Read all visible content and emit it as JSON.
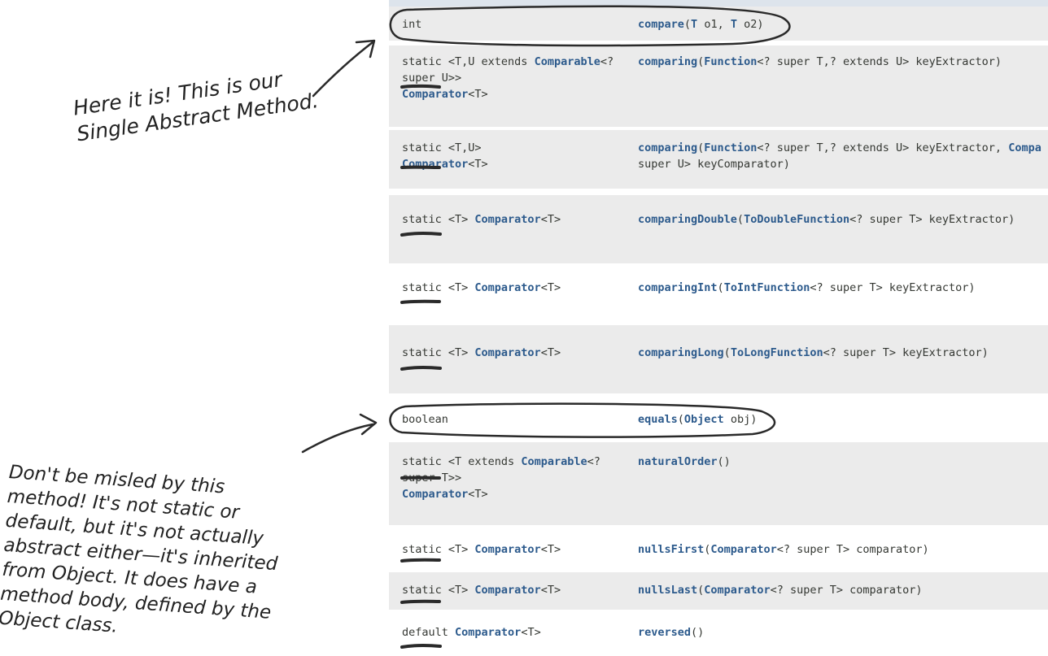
{
  "annotations": {
    "sam_note": "Here it is! This is our Single Abstract Method.",
    "equals_note": "Don't be misled by this method! It's not static or default, but it's not actually abstract either—it's inherited from Object. It does have a method body, defined by the Object class."
  },
  "rows": [
    {
      "mod": [
        "int"
      ],
      "method": [
        [
          "name",
          "compare"
        ],
        [
          "plain",
          "("
        ],
        [
          "type",
          "T"
        ],
        [
          "plain",
          " o1, "
        ],
        [
          "type",
          "T"
        ],
        [
          "plain",
          " o2)"
        ]
      ]
    },
    {
      "mod": [
        "static <T,U extends ",
        [
          "type",
          "Comparable"
        ],
        "<?",
        "\n",
        "super U>>",
        "\n",
        [
          "type",
          "Comparator"
        ],
        "<T>"
      ],
      "method": [
        [
          "name",
          "comparing"
        ],
        [
          "plain",
          "("
        ],
        [
          "type",
          "Function"
        ],
        [
          "plain",
          "<? super T,? extends U> keyExtractor)"
        ]
      ]
    },
    {
      "mod": [
        "static <T,U>",
        "\n",
        [
          "type",
          "Comparator"
        ],
        "<T>"
      ],
      "method": [
        [
          "name",
          "comparing"
        ],
        [
          "plain",
          "("
        ],
        [
          "type",
          "Function"
        ],
        [
          "plain",
          "<? super T,? extends U> keyExtractor, "
        ],
        [
          "type",
          "Compa"
        ],
        [
          "plain",
          "\nsuper U> keyComparator)"
        ]
      ]
    },
    {
      "mod": [
        "static <T> ",
        [
          "type",
          "Comparator"
        ],
        "<T>"
      ],
      "method": [
        [
          "name",
          "comparingDouble"
        ],
        [
          "plain",
          "("
        ],
        [
          "type",
          "ToDoubleFunction"
        ],
        [
          "plain",
          "<? super T> keyExtractor)"
        ]
      ]
    },
    {
      "mod": [
        "static <T> ",
        [
          "type",
          "Comparator"
        ],
        "<T>"
      ],
      "method": [
        [
          "name",
          "comparingInt"
        ],
        [
          "plain",
          "("
        ],
        [
          "type",
          "ToIntFunction"
        ],
        [
          "plain",
          "<? super T> keyExtractor)"
        ]
      ]
    },
    {
      "mod": [
        "static <T> ",
        [
          "type",
          "Comparator"
        ],
        "<T>"
      ],
      "method": [
        [
          "name",
          "comparingLong"
        ],
        [
          "plain",
          "("
        ],
        [
          "type",
          "ToLongFunction"
        ],
        [
          "plain",
          "<? super T> keyExtractor)"
        ]
      ]
    },
    {
      "mod": [
        "boolean"
      ],
      "method": [
        [
          "name",
          "equals"
        ],
        [
          "plain",
          "("
        ],
        [
          "type",
          "Object"
        ],
        [
          "plain",
          " obj)"
        ]
      ]
    },
    {
      "mod": [
        "static <T extends ",
        [
          "type",
          "Comparable"
        ],
        "<?",
        "\n",
        "super T>>",
        "\n",
        [
          "type",
          "Comparator"
        ],
        "<T>"
      ],
      "method": [
        [
          "name",
          "naturalOrder"
        ],
        [
          "plain",
          "()"
        ]
      ]
    },
    {
      "mod": [
        "static <T> ",
        [
          "type",
          "Comparator"
        ],
        "<T>"
      ],
      "method": [
        [
          "name",
          "nullsFirst"
        ],
        [
          "plain",
          "("
        ],
        [
          "type",
          "Comparator"
        ],
        [
          "plain",
          "<? super T> comparator)"
        ]
      ]
    },
    {
      "mod": [
        "static <T> ",
        [
          "type",
          "Comparator"
        ],
        "<T>"
      ],
      "method": [
        [
          "name",
          "nullsLast"
        ],
        [
          "plain",
          "("
        ],
        [
          "type",
          "Comparator"
        ],
        [
          "plain",
          "<? super T> comparator)"
        ]
      ]
    },
    {
      "mod": [
        "default ",
        [
          "type",
          "Comparator"
        ],
        "<T>"
      ],
      "method": [
        [
          "name",
          "reversed"
        ],
        [
          "plain",
          "()"
        ]
      ]
    }
  ]
}
